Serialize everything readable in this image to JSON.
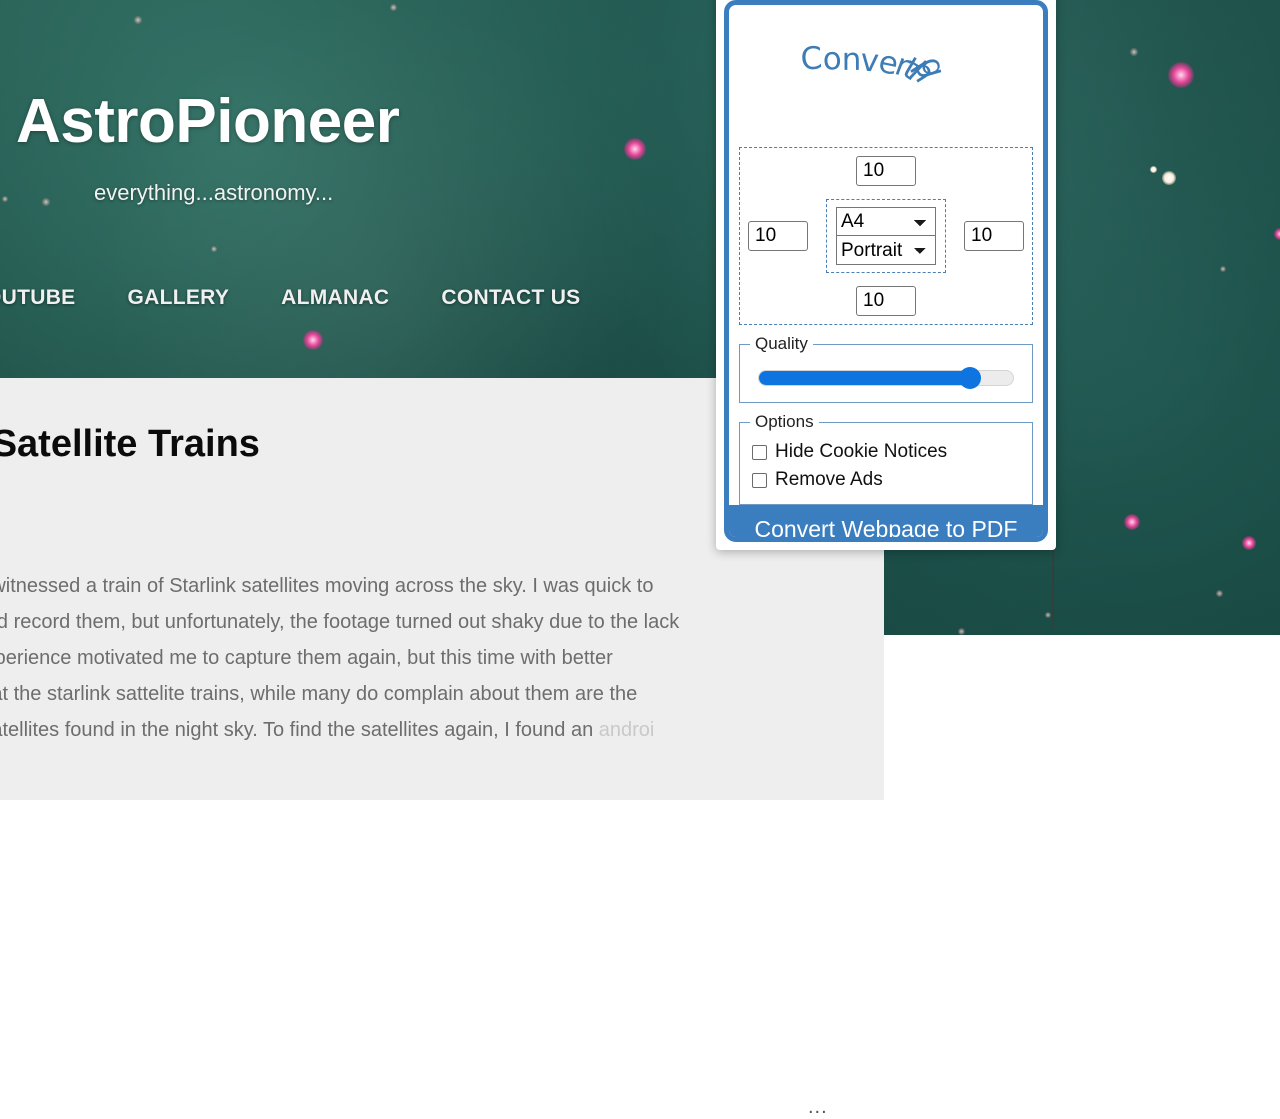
{
  "website": {
    "title": "AstroPioneer",
    "tagline": "everything...astronomy...",
    "nav": [
      {
        "label": "OUTUBE"
      },
      {
        "label": "GALLERY"
      },
      {
        "label": "ALMANAC"
      },
      {
        "label": "CONTACT US"
      }
    ],
    "article": {
      "heading": "k Satellite Trains",
      "line1": "o, I witnessed a train of Starlink satellites moving across the sky. I was quick to",
      "line2": "a and record them, but unfortunately, the footage turned out shaky due to the lack",
      "line3": "s experience motivated me to capture them again, but this time with better",
      "line4": "d that the starlink sattelite trains, while many do complain about them are the",
      "line5_start": "ar satellites found in the night sky. To find the satellites again, I found an ",
      "line5_fade": "androi",
      "ellipsis": "..."
    }
  },
  "popup": {
    "logo_text": "Converting",
    "logo_color": "#3d7cb5",
    "accent_color": "#3a7ebf",
    "margins": {
      "top": "10",
      "left": "10",
      "right": "10",
      "bottom": "10"
    },
    "paper": {
      "size_selected": "A4",
      "size_options": [
        "A4"
      ],
      "orientation_selected": "Portrait",
      "orientation_options": [
        "Portrait"
      ]
    },
    "quality": {
      "legend": "Quality",
      "value": 83,
      "fill_color": "#0d74e0"
    },
    "options": {
      "legend": "Options",
      "items": [
        {
          "label": "Hide Cookie Notices",
          "checked": false
        },
        {
          "label": "Remove Ads",
          "checked": false
        }
      ]
    },
    "convert_button": "Convert Webpage to PDF"
  }
}
